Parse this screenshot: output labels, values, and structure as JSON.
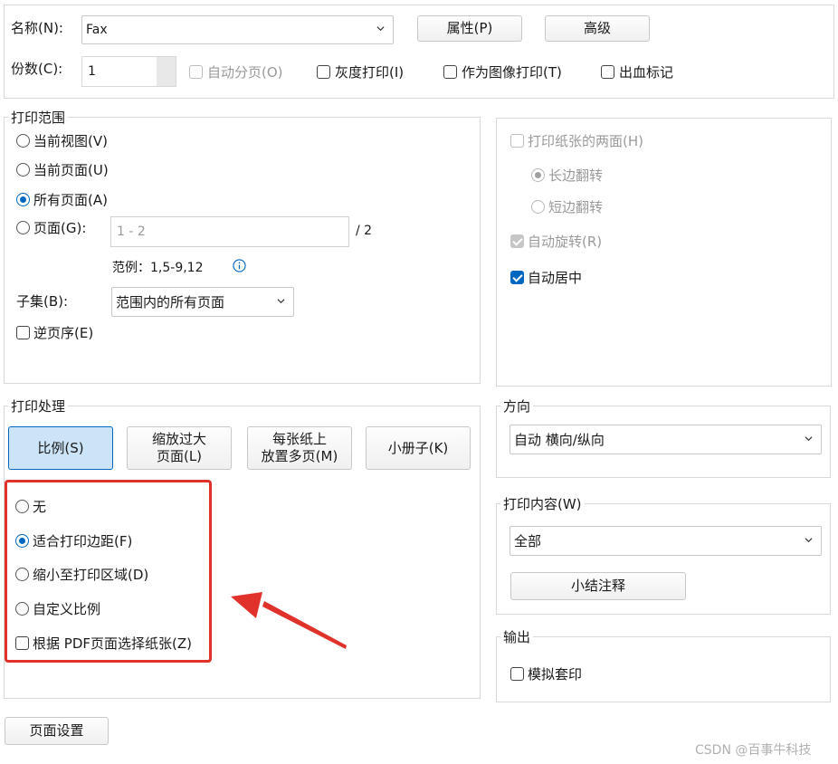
{
  "top": {
    "name_label": "名称(N):",
    "printer_name": "Fax",
    "properties_button": "属性(P)",
    "advanced_button": "高级",
    "copies_label": "份数(C):",
    "copies_value": "1",
    "collate_label": "自动分页(O)",
    "grayscale_label": "灰度打印(I)",
    "print_as_image_label": "作为图像打印(T)",
    "bleed_marks_label": "出血标记"
  },
  "range": {
    "legend": "打印范围",
    "current_view": "当前视图(V)",
    "current_page": "当前页面(U)",
    "all_pages": "所有页面(A)",
    "pages": "页面(G):",
    "pages_placeholder": "1 - 2",
    "total": "/ 2",
    "example": "范例：1,5-9,12",
    "subset_label": "子集(B):",
    "subset_value": "范围内的所有页面",
    "reverse": "逆页序(E)"
  },
  "duplex": {
    "both_sides": "打印纸张的两面(H)",
    "long_edge": "长边翻转",
    "short_edge": "短边翻转",
    "auto_rotate": "自动旋转(R)",
    "auto_center": "自动居中"
  },
  "handling": {
    "legend": "打印处理",
    "tabs": [
      "比例(S)",
      "缩放过大页面(L)",
      "每张纸上放置多页(M)",
      "小册子(K)"
    ],
    "tab_lines": [
      [
        "比例(S)"
      ],
      [
        "缩放过大",
        "页面(L)"
      ],
      [
        "每张纸上",
        "放置多页(M)"
      ],
      [
        "小册子(K)"
      ]
    ],
    "options": [
      "无",
      "适合打印边距(F)",
      "缩小至打印区域(D)",
      "自定义比例"
    ],
    "choose_paper": "根据 PDF页面选择纸张(Z)"
  },
  "orientation": {
    "legend": "方向",
    "value": "自动 横向/纵向"
  },
  "content": {
    "legend": "打印内容(W)",
    "value": "全部",
    "summarize_button": "小结注释"
  },
  "output": {
    "legend": "输出",
    "simulate_overprint": "模拟套印"
  },
  "page_setup_button": "页面设置",
  "watermark": "CSDN @百事牛科技",
  "colors": {
    "accent": "#0067c0",
    "annotation_red": "#e0322b"
  }
}
